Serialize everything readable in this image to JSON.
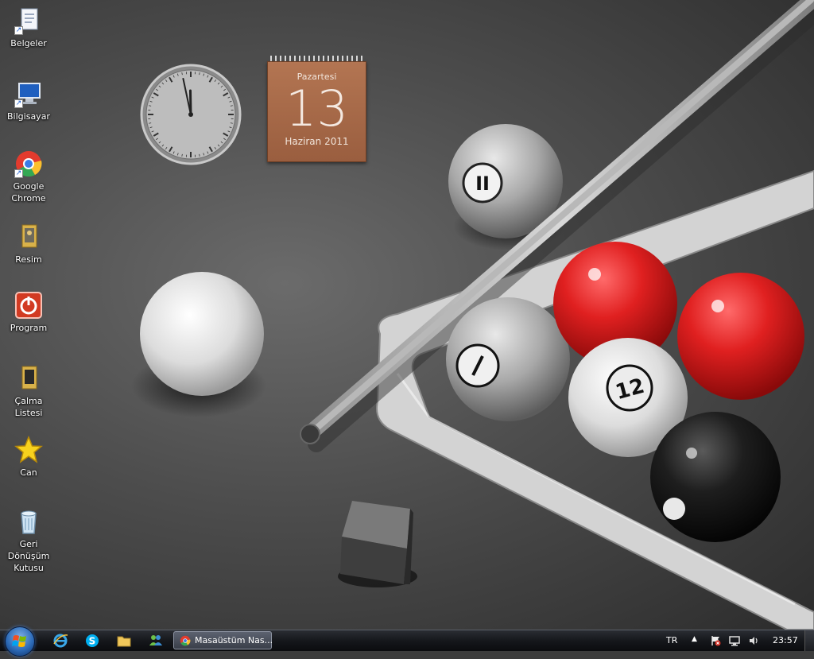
{
  "desktop": {
    "icons": [
      {
        "label": "Belgeler",
        "icon": "documents-icon"
      },
      {
        "label": "Bilgisayar",
        "icon": "computer-icon"
      },
      {
        "label": "Google\nChrome",
        "icon": "chrome-icon"
      },
      {
        "label": "Resim",
        "icon": "picture-folder-icon"
      },
      {
        "label": "Program",
        "icon": "power-icon"
      },
      {
        "label": "Çalma Listesi",
        "icon": "playlist-folder-icon"
      },
      {
        "label": "Can",
        "icon": "star-icon"
      },
      {
        "label": "Geri\nDönüşüm\nKutusu",
        "icon": "recycle-bin-icon"
      }
    ]
  },
  "gadgets": {
    "clock": {
      "hour": 11,
      "minute": 58
    },
    "calendar": {
      "day_name": "Pazartesi",
      "date": "13",
      "month_year": "Haziran 2011"
    }
  },
  "taskbar": {
    "pinned": [
      "internet-explorer-icon",
      "skype-icon",
      "folder-icon",
      "messenger-icon"
    ],
    "tasks": [
      {
        "label": "Masaüstüm Nas...",
        "icon": "chrome-icon"
      }
    ],
    "tray": {
      "language": "TR",
      "clock": "23:57"
    }
  },
  "colors": {
    "calendar": "#a86a48",
    "red_ball": "#d81d1d",
    "taskbar": "#15171b"
  }
}
